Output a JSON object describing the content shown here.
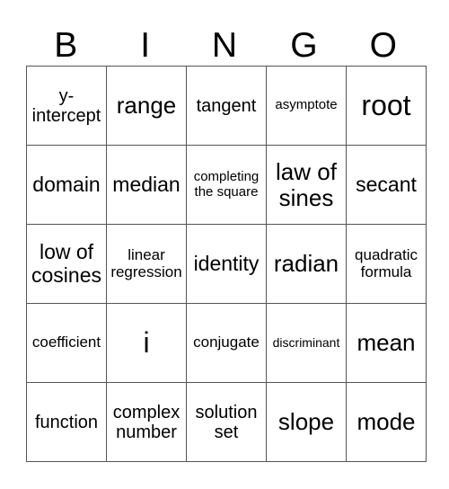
{
  "header": [
    "B",
    "I",
    "N",
    "G",
    "O"
  ],
  "rows": [
    [
      {
        "text": "y-intercept",
        "size": "s-m"
      },
      {
        "text": "range",
        "size": "s-l"
      },
      {
        "text": "tangent",
        "size": "s-m"
      },
      {
        "text": "asymptote",
        "size": "s-xs"
      },
      {
        "text": "root",
        "size": "s-xl"
      }
    ],
    [
      {
        "text": "domain",
        "size": "s-ml"
      },
      {
        "text": "median",
        "size": "s-ml"
      },
      {
        "text": "completing the square",
        "size": "s-xs"
      },
      {
        "text": "law of sines",
        "size": "s-l"
      },
      {
        "text": "secant",
        "size": "s-ml"
      }
    ],
    [
      {
        "text": "low of cosines",
        "size": "s-ml"
      },
      {
        "text": "linear regression",
        "size": "s-s"
      },
      {
        "text": "identity",
        "size": "s-ml"
      },
      {
        "text": "radian",
        "size": "s-l"
      },
      {
        "text": "quadratic formula",
        "size": "s-s"
      }
    ],
    [
      {
        "text": "coefficient",
        "size": "s-s"
      },
      {
        "text": "i",
        "size": "s-xl"
      },
      {
        "text": "conjugate",
        "size": "s-s"
      },
      {
        "text": "discriminant",
        "size": "s-xxs"
      },
      {
        "text": "mean",
        "size": "s-l"
      }
    ],
    [
      {
        "text": "function",
        "size": "s-m"
      },
      {
        "text": "complex number",
        "size": "s-m"
      },
      {
        "text": "solution set",
        "size": "s-m"
      },
      {
        "text": "slope",
        "size": "s-l"
      },
      {
        "text": "mode",
        "size": "s-l"
      }
    ]
  ]
}
